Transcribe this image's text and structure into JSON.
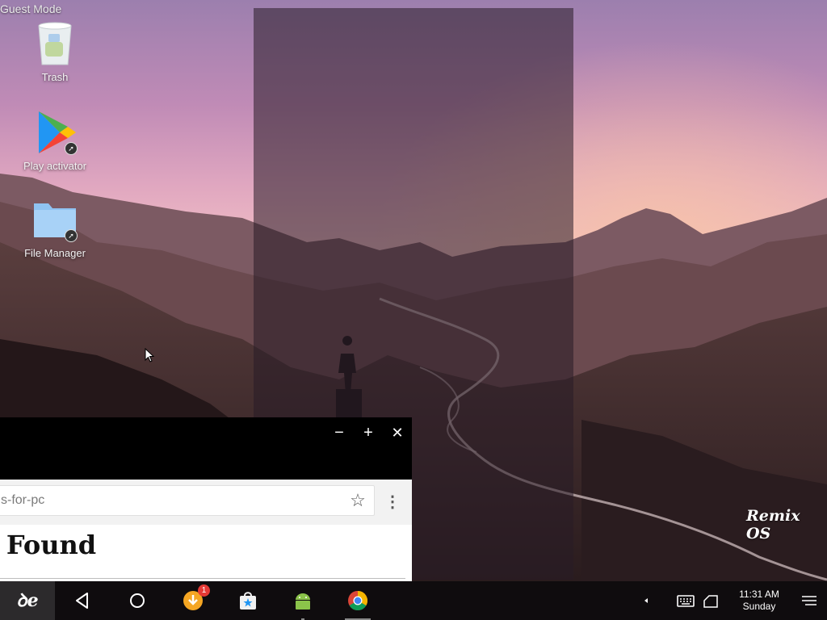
{
  "system": {
    "guest_mode_label": "Guest Mode"
  },
  "desktop": {
    "icons": [
      {
        "label": "Trash",
        "icon": "trash-icon"
      },
      {
        "label": "Play activator",
        "icon": "play-store-icon"
      },
      {
        "label": "File Manager",
        "icon": "folder-icon"
      }
    ],
    "watermark": "Remix OS"
  },
  "browser": {
    "window_controls": {
      "minimize": "−",
      "maximize": "+",
      "close": "✕"
    },
    "omnibox_text": "s-for-pc",
    "page_heading": "t Found"
  },
  "taskbar": {
    "start_glyph": "ꝺe",
    "notification_count": "1",
    "clock": {
      "time": "11:31 AM",
      "day": "Sunday"
    },
    "pinned_apps": [
      "download-manager-icon",
      "app-store-icon",
      "android-icon",
      "chrome-icon"
    ]
  },
  "colors": {
    "taskbar": "#0f0c0e",
    "badge": "#e53935",
    "folder": "#8fc3f2"
  }
}
